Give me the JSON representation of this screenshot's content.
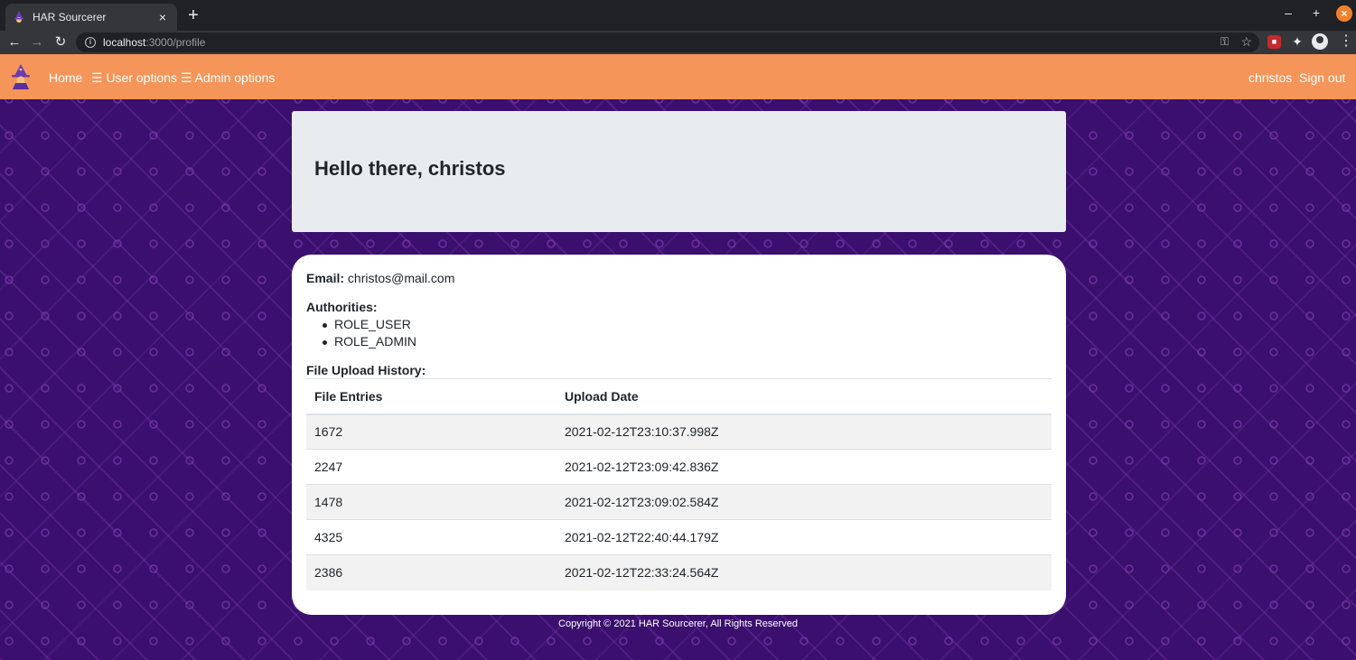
{
  "browser": {
    "tab_title": "HAR Sourcerer",
    "tab_close": "×",
    "new_tab": "+",
    "window_min": "–",
    "window_max": "+",
    "window_close": "×",
    "url_host": "localhost",
    "url_path": ":3000/profile"
  },
  "navbar": {
    "home": "Home",
    "user_options": "☰ User options",
    "admin_options": "☰ Admin options",
    "username": "christos",
    "sign_out": "Sign out",
    "accent_color": "#f5955a"
  },
  "jumbotron": {
    "greeting": "Hello there, christos"
  },
  "profile": {
    "email_label": "Email:",
    "email_value": " christos@mail.com",
    "authorities_label": "Authorities:",
    "authorities": [
      "ROLE_USER",
      "ROLE_ADMIN"
    ],
    "history_label": "File Upload History:"
  },
  "table": {
    "headers": [
      "File Entries",
      "Upload Date"
    ],
    "rows": [
      [
        "1672",
        "2021-02-12T23:10:37.998Z"
      ],
      [
        "2247",
        "2021-02-12T23:09:42.836Z"
      ],
      [
        "1478",
        "2021-02-12T23:09:02.584Z"
      ],
      [
        "4325",
        "2021-02-12T22:40:44.179Z"
      ],
      [
        "2386",
        "2021-02-12T22:33:24.564Z"
      ]
    ]
  },
  "footer": {
    "copyright": "Copyright © 2021 HAR Sourcerer, All Rights Reserved"
  }
}
